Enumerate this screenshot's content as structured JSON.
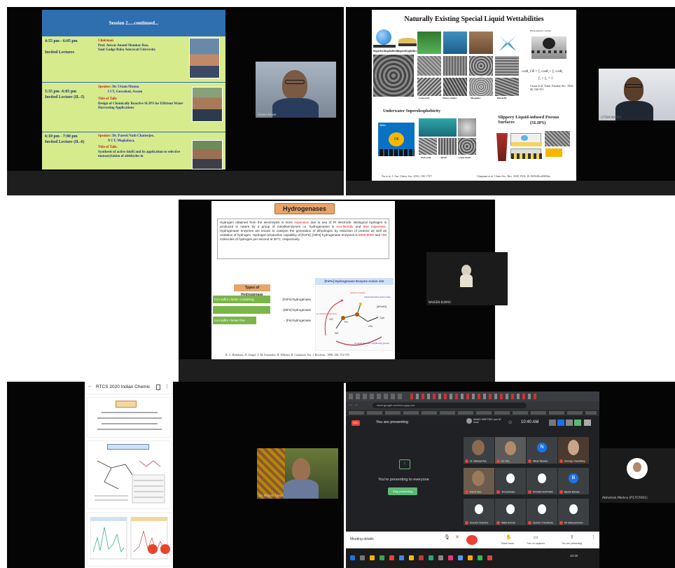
{
  "tile1": {
    "header": "Session 2.....continued...",
    "rows": [
      {
        "time": "4:55 pm - 6:05 pm",
        "type": "Invited Lectures",
        "role": "Chairman",
        "name": "Prof. Anwar Anand Shankar Rao,",
        "affil": "Sant Gadge Baba Amravati University"
      },
      {
        "time": "5:35 pm -6:05 pm",
        "type": "Invited Lecture (IL-5)",
        "role": "Speaker:",
        "name": "Dr. Uttam Manna",
        "affil": "I I T, Guwahati, Assam",
        "title_label": "Title of Talk:",
        "title": "Design of Chemically Reactive SLIPS for Efficient Water Harvesting Applications"
      },
      {
        "time": "6:10 pm - 7:00 pm",
        "type": "Invited Lecture (IL-6)",
        "role": "Speaker:",
        "name": "Dr. Paresh Nath Chatterjee,",
        "affil": "N I T, Meghalaya,",
        "title_label": "Title of Talk:",
        "title": "Synthesis of active tin(0) and its application to selective monoarylation of aldehydes in"
      }
    ],
    "video_name": "Anand Anwar"
  },
  "tile2": {
    "title": "Naturally Existing Special Liquid Wettabilities",
    "labels": {
      "superhydrophobicity": "Superhydrophobicity",
      "superoleophilicity": "Superoleophilicity",
      "underwater": "Underwater Superoleophobicity",
      "slips": "Slippery Liquid-infused Porous Surfaces",
      "slips_abbr": "(SLIPS)",
      "water": "Water",
      "oil": "Oil",
      "lotus": "Lotus leaf",
      "water_strider": "Water strider",
      "mosquito": "Mosquito",
      "butterfly": "Butterfly",
      "fish_scale": "Fish scale",
      "shark": "Shark",
      "clam": "Clam shells"
    },
    "equation1": "cosθ_CB = f₁ cosθ₁+ f₂ cosθ₂",
    "equation2": "f₁ + f₂ = 1",
    "cassie": "Cassie et al. Trans. Faraday Soc. 1944, 40, 546-551",
    "hydrophobic_label": "Hydrophobic coating",
    "cite_left": "Xu et al. J. Am. Chem. Soc. 2016, 138, 1727.",
    "cite_right": "Chapman et al. Chem Soc. Rev. 2020, DOI: 10.1039/d0cs00656a.",
    "video_name": "UTTAM MANNA"
  },
  "tile3": {
    "title": "Hydrogenases",
    "para": [
      {
        "t": "Hydrogen obtained from the electrolysis is more ",
        "c": ""
      },
      {
        "t": "expensive",
        "c": "red"
      },
      {
        "t": " due to use of Pt electrode. Biological hydrogen is produced in nature by a group of metalloenzymes i.e. hydrogenases is ",
        "c": ""
      },
      {
        "t": "eco-friendly",
        "c": "red"
      },
      {
        "t": " and ",
        "c": ""
      },
      {
        "t": "less expensive",
        "c": "red"
      },
      {
        "t": ". Hydrogenase enzymes are known to catalyze the generation of dihydrogen by reduction of protons as well as oxidation of hydrogen. Hydrogen production capability of [FeFe], [NiFe] hydrogenase enzymes is ",
        "c": ""
      },
      {
        "t": "6000-9000",
        "c": "red"
      },
      {
        "t": " and ",
        "c": ""
      },
      {
        "t": "700",
        "c": "red"
      },
      {
        "t": " molecules of hydrogen per second at 30°C, respectively.",
        "c": ""
      }
    ],
    "types_label": "Types of Hydrogenase",
    "table": [
      {
        "left": "Iron-sulfur cluster containing",
        "right": "- [FeFe]-hydrogenase"
      },
      {
        "left": "",
        "right": "- [NiFe]-hydrogenase"
      },
      {
        "left": "Iron-sulfur cluster-free",
        "right": "- [Fe]-hydrogenase"
      }
    ],
    "active_site": "[FeFe] Hydrogenase Enzyme Active site",
    "diagram_labels": {
      "electron": "electron transfer",
      "fe4s4": "[4Fe4S]",
      "cys": "Cys",
      "h2": "H₂ binding/ unbinding",
      "proton": "(Intramolecular) proton relay",
      "coupling": "coupling between neighboring groups",
      "nc": "NC",
      "cn": "CN",
      "fe": "Fe",
      "oc": "OC"
    },
    "cite": "K. C. Henkhans, N. Zeegel, Y. M. Fernandez, B. Willems, R. Cammack, Eur. J. Biochem., 1998, 258, 572-578.",
    "video_name": "NAVEEN KUMAR"
  },
  "tile4": {
    "app_title": "RTCS 2020 Indian Chemic",
    "video_name": "Dr. Manish Tiwari"
  },
  "tile5": {
    "url": "meet.google.com/xxx-yyyy-zzz",
    "rec": "REC",
    "presenting_label": "You are presenting",
    "meeting_info": "NINAD MEETING and 30 more",
    "clock": "10:40 AM",
    "present_text": "You're presenting to everyone",
    "stop_button": "Stop presenting",
    "participants": [
      {
        "name": "Dr. Mandal Pat..",
        "avatar": "",
        "color": "#5a4a3c"
      },
      {
        "name": "Dr. Pal...",
        "avatar": "",
        "color": "#6b5b4d"
      },
      {
        "name": "Nibari Biswas",
        "avatar": "N",
        "color": "#1a73e8"
      },
      {
        "name": "Anurag Chaudhary",
        "avatar": "",
        "color": "#4a3a30"
      },
      {
        "name": "Karmi Rao",
        "avatar": "",
        "color": "#6b5b4d"
      },
      {
        "name": "Jil hashiraku",
        "avatar": "",
        "color": "#3c4043"
      },
      {
        "name": "ROSNA SUPHIAN",
        "avatar": "",
        "color": "#3c4043"
      },
      {
        "name": "Biplab Biswas",
        "avatar": "B",
        "color": "#1a73e8"
      },
      {
        "name": "Anushri Chandra",
        "avatar": "",
        "color": "#3c4043"
      },
      {
        "name": "Wafa Kumari",
        "avatar": "",
        "color": "#3c4043"
      },
      {
        "name": "Suman Choudhary",
        "avatar": "",
        "color": "#3c4043"
      },
      {
        "name": "Mr Sathyamohan",
        "avatar": "",
        "color": "#3c4043"
      }
    ],
    "meeting_details": "Meeting details",
    "controls": {
      "raise_hand": "Raise hand",
      "captions": "Turn on captions",
      "present": "You are presenting"
    },
    "side_name": "Abhishek Mishra (P17CY001)",
    "taskbar_time": "10:40"
  }
}
